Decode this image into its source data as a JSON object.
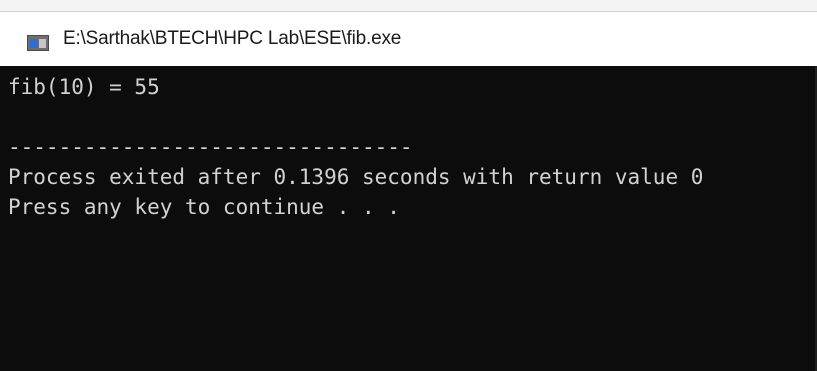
{
  "window": {
    "title": "E:\\Sarthak\\BTECH\\HPC Lab\\ESE\\fib.exe",
    "icon": "console-app-icon"
  },
  "console": {
    "lines": [
      "fib(10) = 55",
      "",
      "--------------------------------",
      "Process exited after 0.1396 seconds with return value 0",
      "Press any key to continue . . ."
    ]
  },
  "colors": {
    "console_background": "#0c0c0c",
    "console_text": "#d2d2d2",
    "titlebar_background": "#ffffff"
  }
}
